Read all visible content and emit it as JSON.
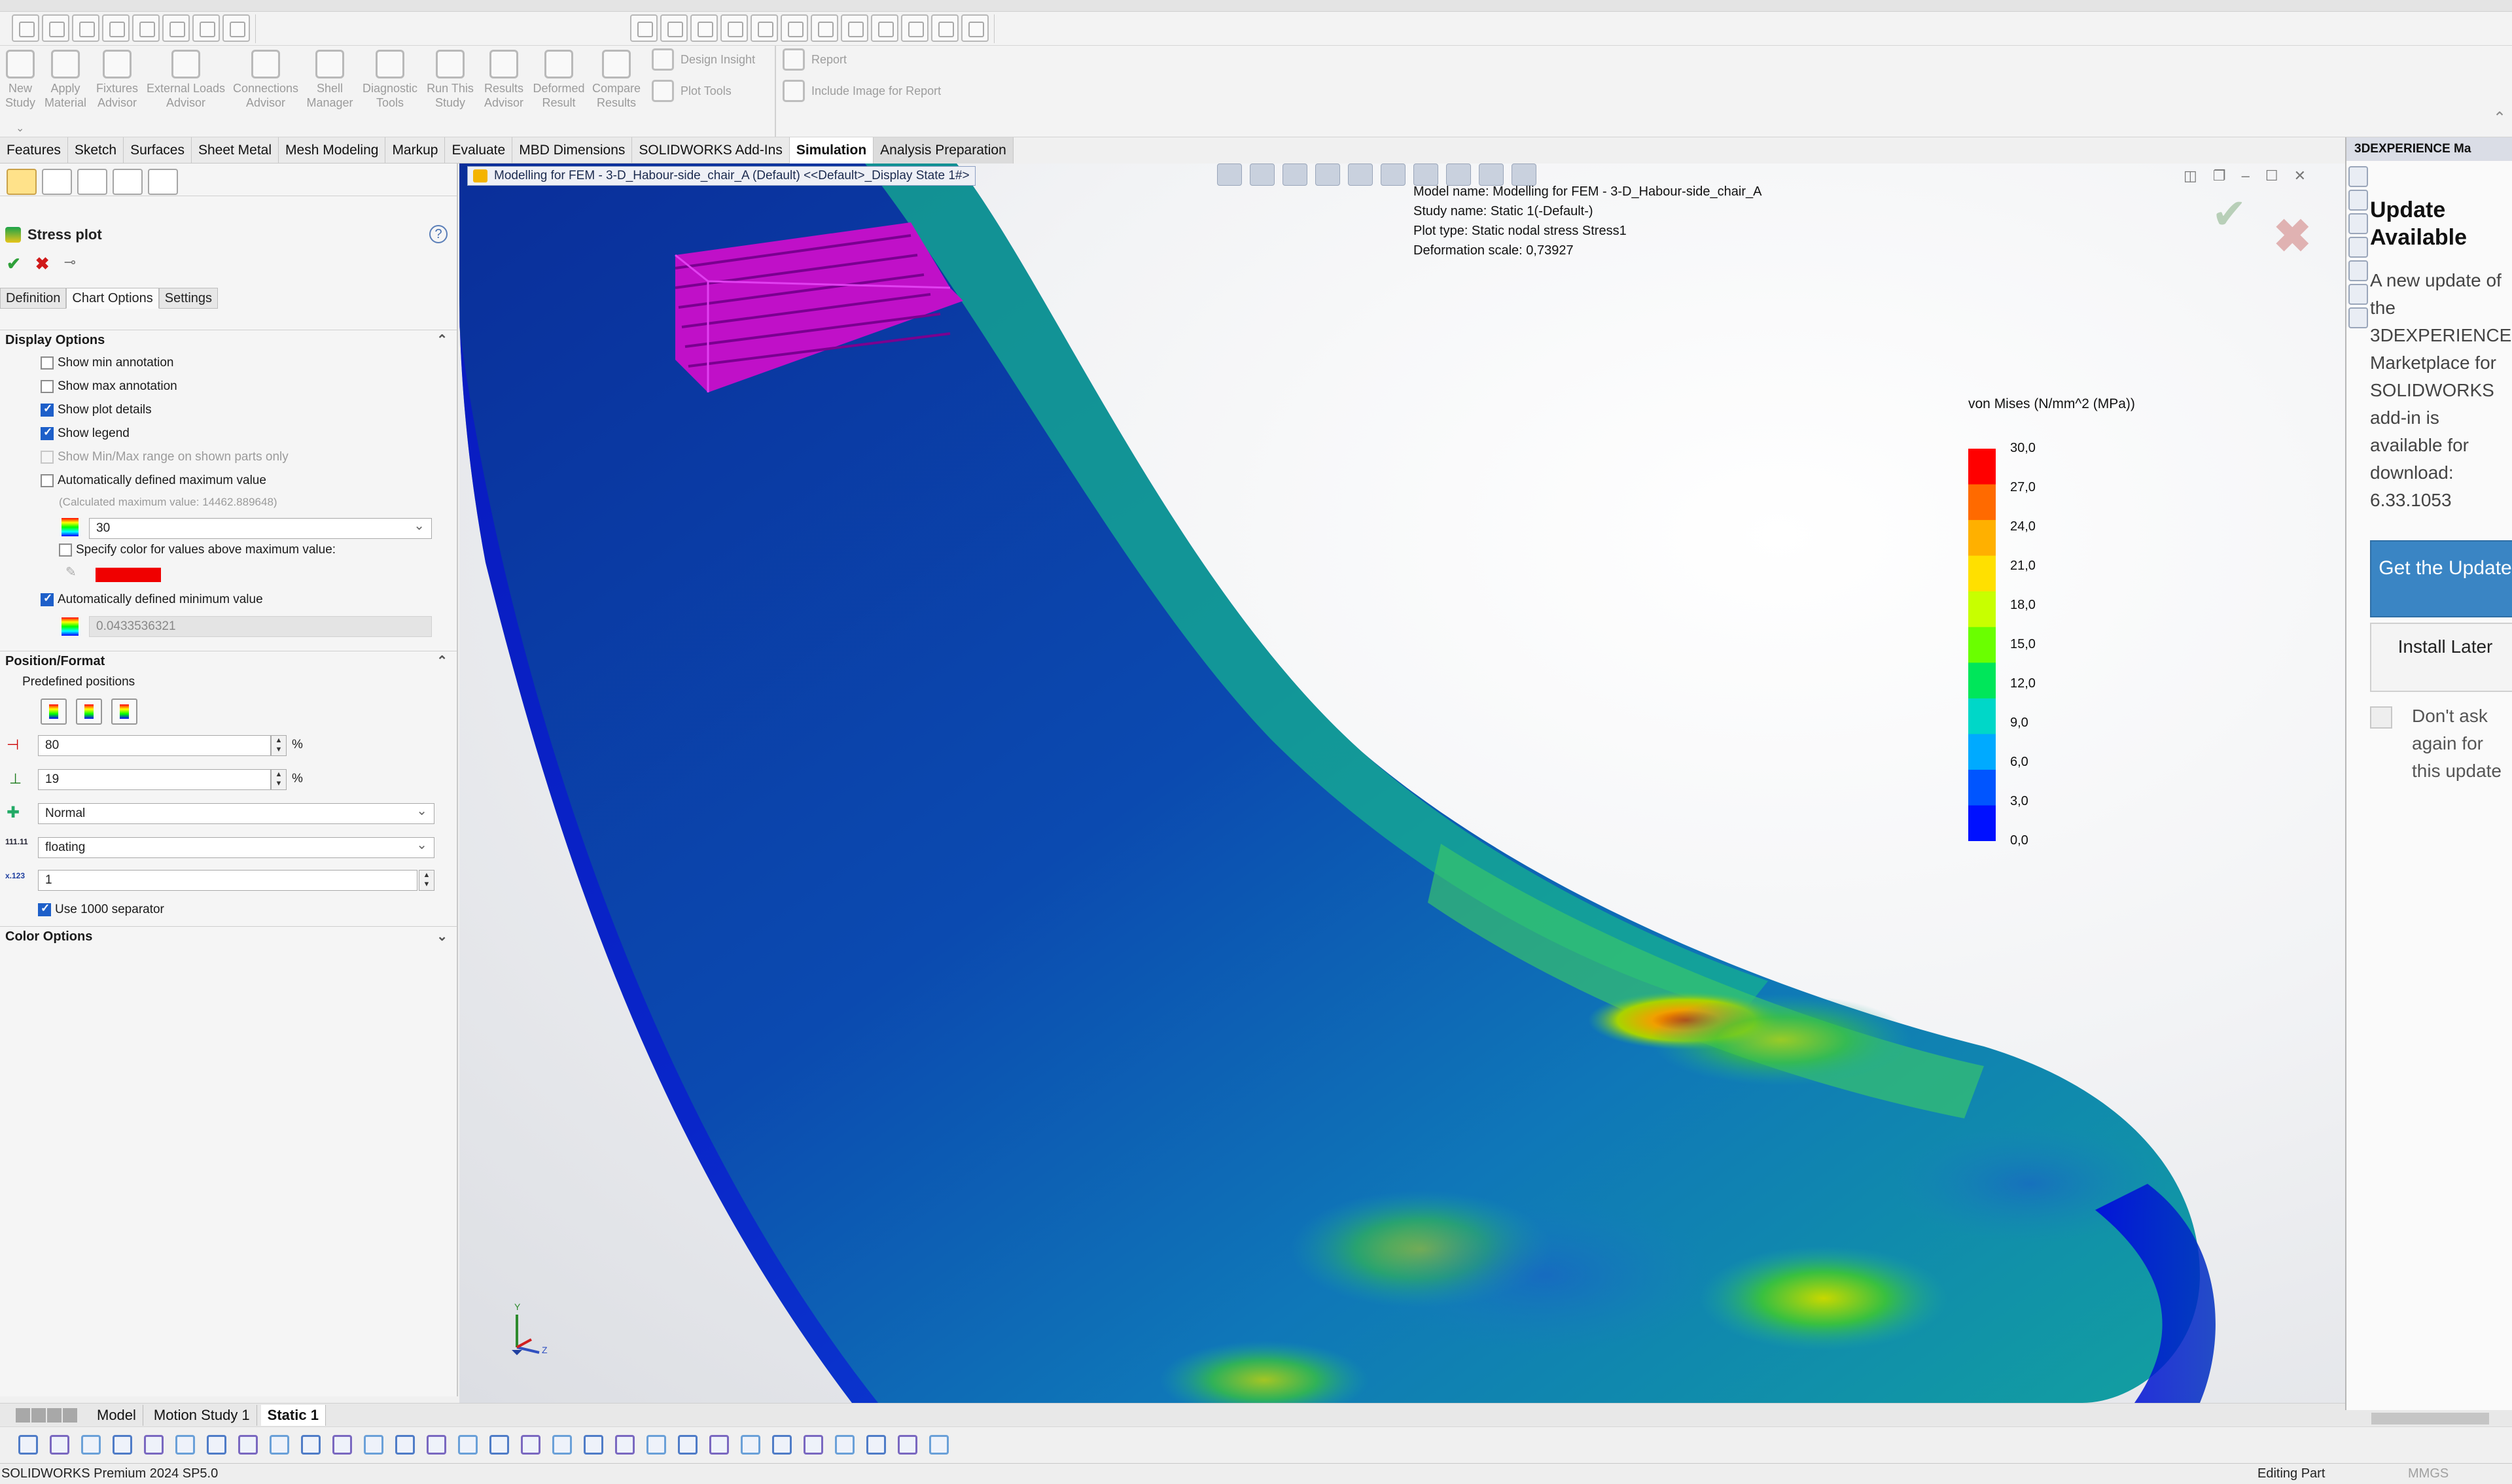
{
  "toolbar": {
    "commands": [
      {
        "label": "New Study",
        "icon": "new-study-icon"
      },
      {
        "label": "Apply Material",
        "icon": "apply-material-icon"
      },
      {
        "label": "Fixtures Advisor",
        "icon": "fixtures-advisor-icon"
      },
      {
        "label": "External Loads Advisor",
        "icon": "external-loads-icon"
      },
      {
        "label": "Connections Advisor",
        "icon": "connections-advisor-icon"
      },
      {
        "label": "Shell Manager",
        "icon": "shell-manager-icon"
      },
      {
        "label": "Diagnostic Tools",
        "icon": "diagnostic-tools-icon"
      },
      {
        "label": "Run This Study",
        "icon": "run-study-icon"
      },
      {
        "label": "Results Advisor",
        "icon": "results-advisor-icon"
      },
      {
        "label": "Deformed Result",
        "icon": "deformed-result-icon"
      },
      {
        "label": "Compare Results",
        "icon": "compare-results-icon"
      }
    ],
    "small_commands": [
      {
        "label": "Design Insight"
      },
      {
        "label": "Plot Tools"
      },
      {
        "label": "Report"
      },
      {
        "label": "Include Image for Report"
      }
    ]
  },
  "cm_tabs": [
    "Features",
    "Sketch",
    "Surfaces",
    "Sheet Metal",
    "Mesh Modeling",
    "Markup",
    "Evaluate",
    "MBD Dimensions",
    "SOLIDWORKS Add-Ins",
    "Simulation",
    "Analysis Preparation"
  ],
  "cm_active": "Simulation",
  "property_manager": {
    "title": "Stress plot",
    "help": "?",
    "tabs": [
      "Definition",
      "Chart Options",
      "Settings"
    ],
    "active_tab": "Chart Options",
    "display_options": {
      "heading": "Display Options",
      "show_min_annotation": {
        "label": "Show min annotation",
        "checked": false
      },
      "show_max_annotation": {
        "label": "Show max annotation",
        "checked": false
      },
      "show_plot_details": {
        "label": "Show plot details",
        "checked": true
      },
      "show_legend": {
        "label": "Show legend",
        "checked": true
      },
      "show_minmax_range": {
        "label": "Show Min/Max range on shown parts only",
        "checked": false,
        "disabled": true
      },
      "auto_max": {
        "label": "Automatically defined maximum value",
        "checked": false
      },
      "calc_max": "(Calculated maximum value: 14462.889648)",
      "max_value": "30",
      "specify_color": {
        "label": "Specify color for values above maximum value:",
        "checked": false
      },
      "above_max_color": "#f00000",
      "auto_min": {
        "label": "Automatically defined minimum value",
        "checked": true
      },
      "min_value": "0.0433536321"
    },
    "position_format": {
      "heading": "Position/Format",
      "predefined_label": "Predefined positions",
      "x_pos": "80",
      "y_pos": "19",
      "unit": "%",
      "orientation": "Normal",
      "number_format": "floating",
      "decimals": "1",
      "use_1000_sep": {
        "label": "Use 1000 separator",
        "checked": true
      }
    },
    "color_options": {
      "heading": "Color Options"
    }
  },
  "viewport": {
    "doc_tab": "Modelling for FEM - 3-D_Habour-side_chair_A (Default) <<Default>_Display State 1#>",
    "plot_info": [
      "Model name: Modelling for FEM - 3-D_Habour-side_chair_A",
      "Study name: Static 1(-Default-)",
      "Plot type: Static nodal stress Stress1",
      "Deformation scale: 0,73927"
    ],
    "legend": {
      "title": "von Mises (N/mm^2 (MPa))",
      "ticks": [
        "30,0",
        "27,0",
        "24,0",
        "21,0",
        "18,0",
        "15,0",
        "12,0",
        "9,0",
        "6,0",
        "3,0",
        "0,0"
      ],
      "colors": [
        "#ff0000",
        "#ff6a00",
        "#ffb000",
        "#ffe000",
        "#c8ff00",
        "#6aff00",
        "#00e65a",
        "#00d7c8",
        "#00aaff",
        "#0055ff",
        "#0010ff"
      ]
    },
    "triad": {
      "y": "Y",
      "z": "Z"
    }
  },
  "task_pane": {
    "header": "3DEXPERIENCE Ma",
    "title": "Update Available",
    "message": "A new update of the 3DEXPERIENCE Marketplace for SOLIDWORKS add-in is available for download: 6.33.1053",
    "get_update": "Get the Update",
    "install_later": "Install Later",
    "dont_ask": "Don't ask again for this update"
  },
  "bottom_tabs": [
    "Model",
    "Motion Study 1",
    "Static 1"
  ],
  "bottom_active": "Static 1",
  "status_bar": {
    "product": "SOLIDWORKS Premium 2024 SP5.0",
    "mode": "Editing Part",
    "units": "MMGS"
  }
}
